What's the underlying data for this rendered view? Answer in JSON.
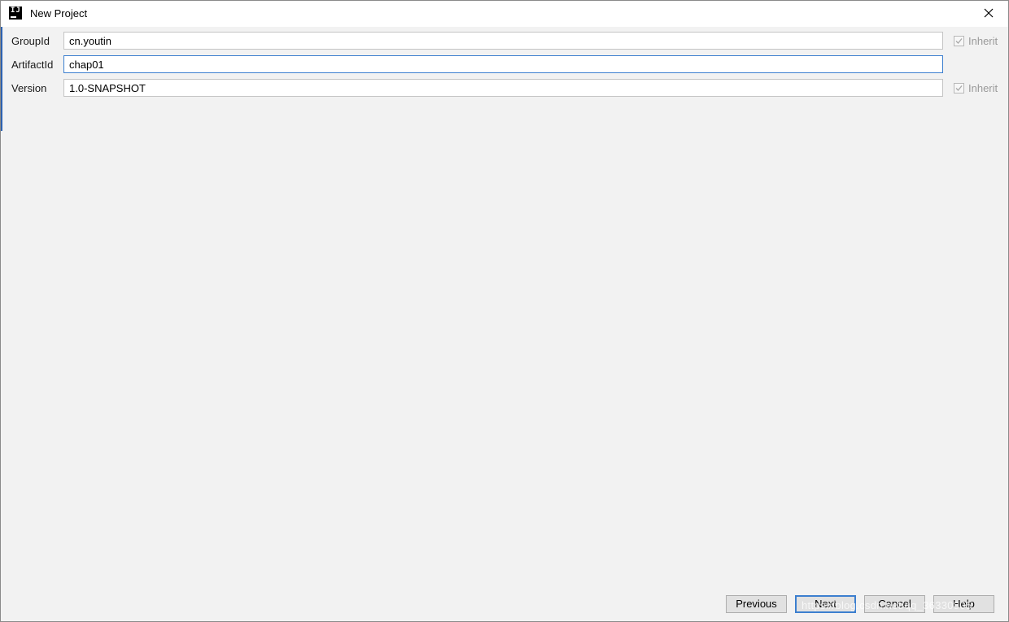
{
  "window": {
    "title": "New Project",
    "app_icon_text": "IJ"
  },
  "form": {
    "rows": [
      {
        "label": "GroupId",
        "value": "cn.youtin",
        "inherit_label": "Inherit",
        "inherit_checked": true,
        "inherit_enabled": false
      },
      {
        "label": "ArtifactId",
        "value": "chap01"
      },
      {
        "label": "Version",
        "value": "1.0-SNAPSHOT",
        "inherit_label": "Inherit",
        "inherit_checked": true,
        "inherit_enabled": false
      }
    ]
  },
  "buttons": {
    "previous": "Previous",
    "next": "Next",
    "cancel": "Cancel",
    "help": "Help"
  },
  "watermark": "https://blog.csdn.net/qq_36330805",
  "colors": {
    "focus_border": "#3c7fcf",
    "background": "#f2f2f2"
  }
}
